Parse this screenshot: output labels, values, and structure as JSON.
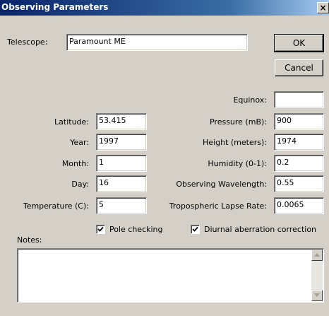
{
  "window": {
    "title": "Observing Parameters",
    "close_glyph": "×"
  },
  "telescope": {
    "label": "Telescope:",
    "value": "Paramount ME"
  },
  "buttons": {
    "ok": "OK",
    "cancel": "Cancel"
  },
  "left_fields": [
    {
      "label": "Latitude:",
      "value": "53.415"
    },
    {
      "label": "Year:",
      "value": "1997"
    },
    {
      "label": "Month:",
      "value": "1"
    },
    {
      "label": "Day:",
      "value": "16"
    },
    {
      "label": "Temperature (C):",
      "value": "5"
    }
  ],
  "right_fields": [
    {
      "label": "Equinox:",
      "value": ""
    },
    {
      "label": "Pressure (mB):",
      "value": "900"
    },
    {
      "label": "Height (meters):",
      "value": "1974"
    },
    {
      "label": "Humidity (0-1):",
      "value": "0.2"
    },
    {
      "label": "Observing Wavelength:",
      "value": "0.55"
    },
    {
      "label": "Tropospheric Lapse Rate:",
      "value": "0.0065"
    }
  ],
  "checkboxes": {
    "pole": {
      "label": "Pole checking",
      "checked": true
    },
    "diurnal": {
      "label": "Diurnal aberration correction",
      "checked": true
    }
  },
  "notes": {
    "label": "Notes:",
    "value": ""
  },
  "icons": {
    "close": "close-icon",
    "check": "check-icon",
    "scroll_up": "scroll-up-arrow-icon",
    "scroll_down": "scroll-down-arrow-icon"
  }
}
